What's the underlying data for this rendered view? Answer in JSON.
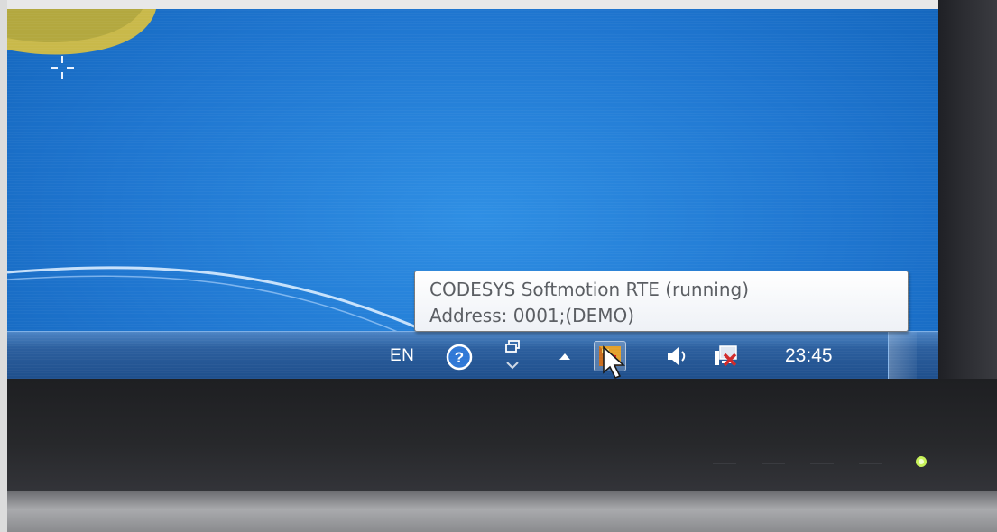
{
  "tooltip": {
    "line1": "CODESYS Softmotion RTE (running)",
    "line2": "Address: 0001;(DEMO)"
  },
  "taskbar": {
    "language": "EN",
    "clock": "23:45",
    "tray_icons": [
      "help-icon",
      "network-arrows-icon",
      "show-hidden-icons-icon",
      "codesys-runtime-icon",
      "volume-icon",
      "network-disconnected-icon"
    ]
  },
  "colors": {
    "desktop_blue": "#1f76d0",
    "taskbar_blue": "#2c5f9e",
    "tooltip_text": "#5a5d62",
    "network_error_red": "#d22a2a"
  }
}
